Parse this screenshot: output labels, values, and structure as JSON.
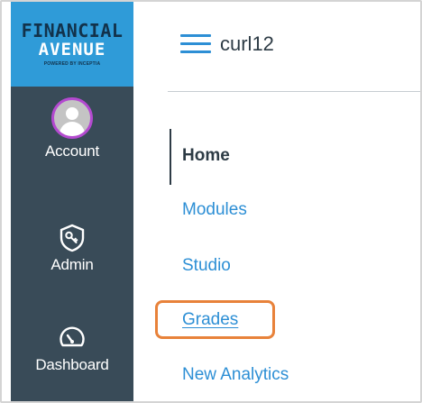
{
  "brand": {
    "line1": "FINANCIAL",
    "line2": "AVENUE",
    "line3": "POWERED BY INCEPTIA"
  },
  "global_nav": {
    "items": [
      {
        "label": "Account",
        "icon": "user-avatar-icon"
      },
      {
        "label": "Admin",
        "icon": "shield-icon"
      },
      {
        "label": "Dashboard",
        "icon": "speedometer-icon"
      }
    ]
  },
  "header": {
    "breadcrumb": "curl12"
  },
  "course_nav": {
    "items": [
      {
        "label": "Home",
        "active": true
      },
      {
        "label": "Modules"
      },
      {
        "label": "Studio"
      },
      {
        "label": "Grades",
        "highlighted": true
      },
      {
        "label": "New Analytics"
      }
    ]
  },
  "colors": {
    "global_nav_bg": "#394b58",
    "brand_bg": "#2f9bd8",
    "link": "#2d8fd5",
    "avatar_ring": "#b44ad0",
    "highlight": "#e8823a"
  }
}
